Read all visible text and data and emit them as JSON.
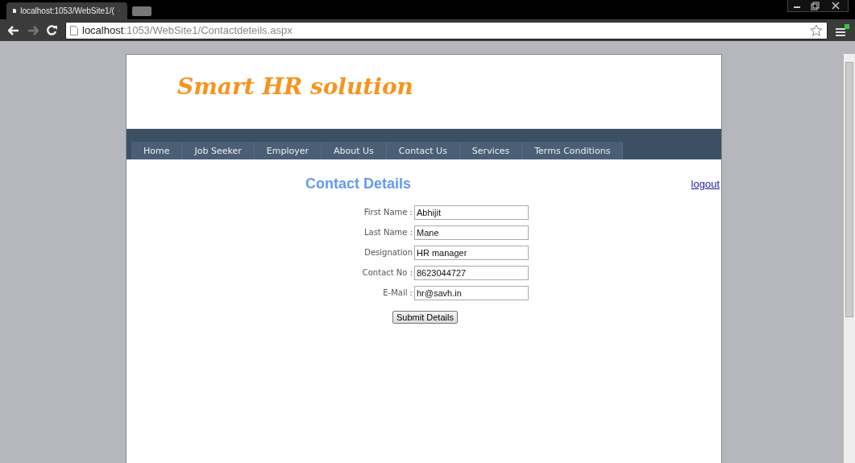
{
  "browser": {
    "tab_title": "localhost:1053/WebSite1/(",
    "url_host": "localhost",
    "url_path": ":1053/WebSite1/Contactdeteils.aspx"
  },
  "site": {
    "logo": "Smart HR solution",
    "nav": [
      {
        "label": "Home"
      },
      {
        "label": "Job Seeker"
      },
      {
        "label": "Employer"
      },
      {
        "label": "About Us"
      },
      {
        "label": "Contact Us"
      },
      {
        "label": "Services"
      },
      {
        "label": "Terms Conditions"
      }
    ],
    "heading": "Contact Details",
    "logout": "logout",
    "fields": [
      {
        "label": "First Name :",
        "value": "Abhijit"
      },
      {
        "label": "Last Name :",
        "value": "Mane"
      },
      {
        "label": "Designation",
        "value": "HR manager"
      },
      {
        "label": "Contact No :",
        "value": "8623044727"
      },
      {
        "label": "E-Mail :",
        "value": "hr@savh.in"
      }
    ],
    "submit": "Submit Details"
  }
}
